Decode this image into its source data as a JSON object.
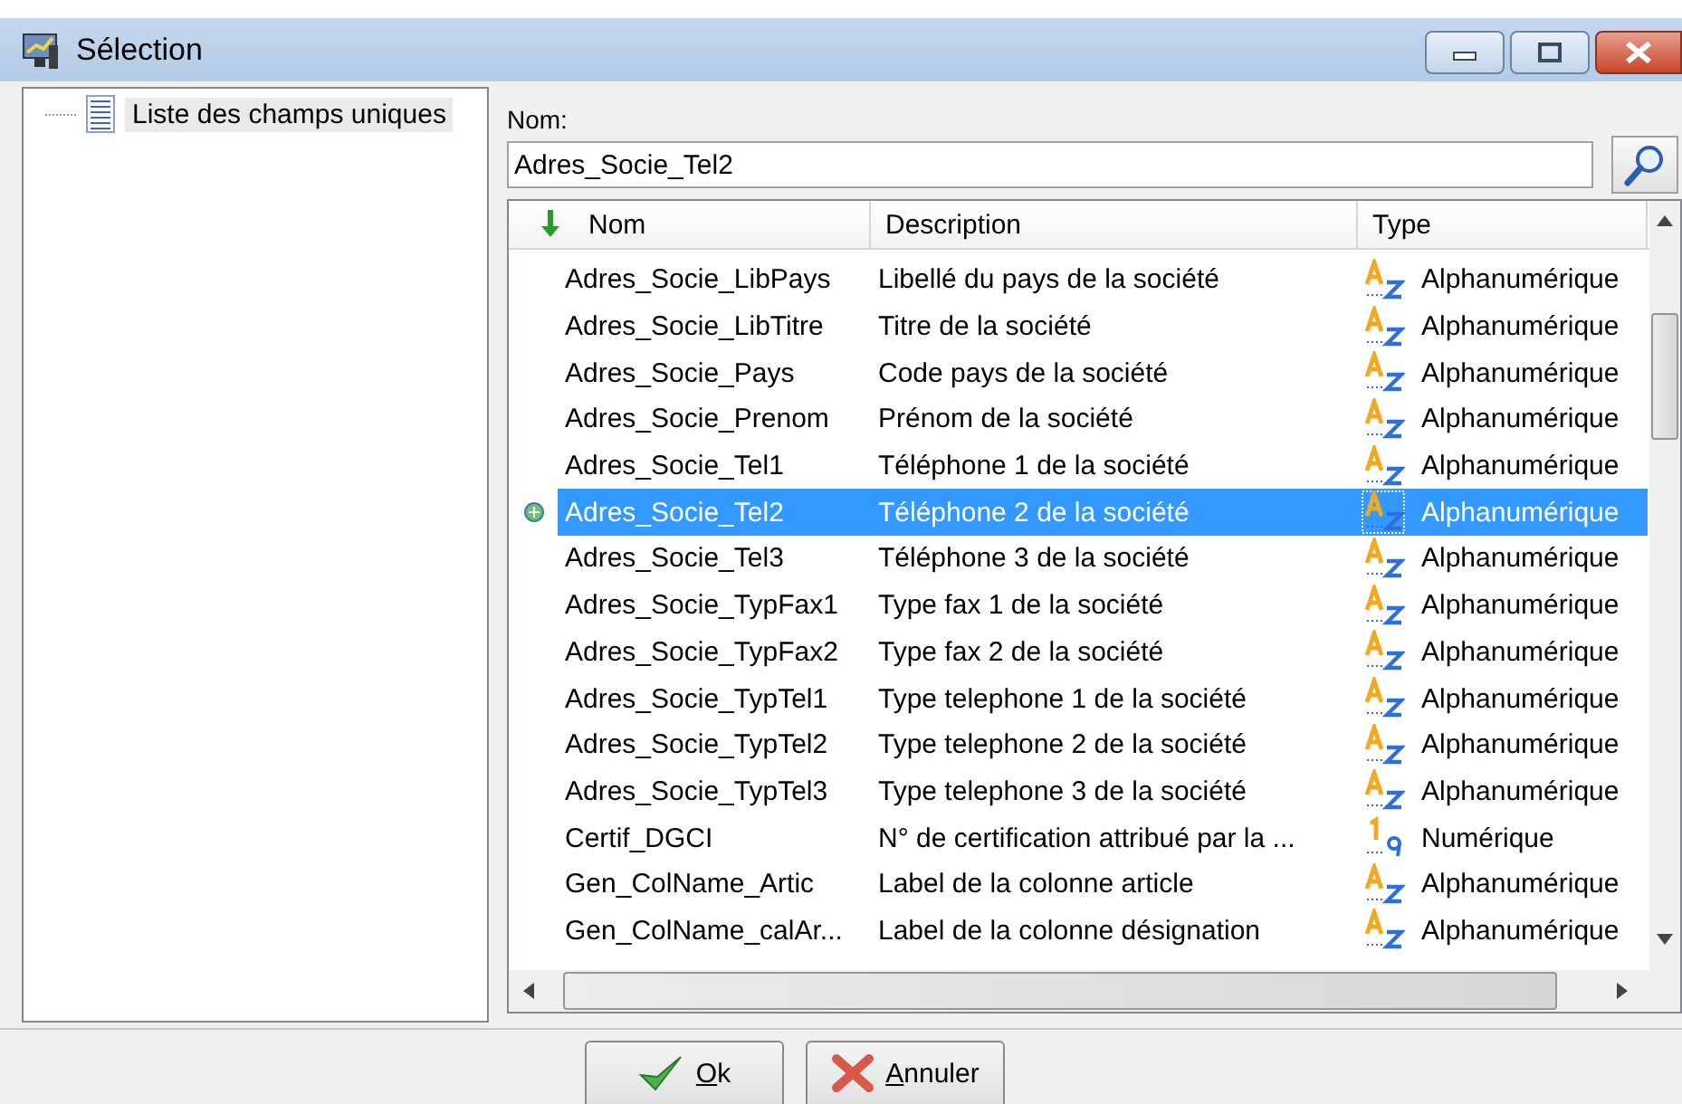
{
  "window": {
    "title": "Sélection"
  },
  "tree": {
    "items": [
      {
        "label": "Liste des champs uniques",
        "selected": true
      }
    ]
  },
  "name_field": {
    "label": "Nom:",
    "value": "Adres_Socie_Tel2"
  },
  "table": {
    "columns": [
      {
        "label": "Nom",
        "sorted": true
      },
      {
        "label": "Description",
        "sorted": false
      },
      {
        "label": "Type",
        "sorted": false
      }
    ],
    "rows": [
      {
        "name": "Adres_Socie_LibPays",
        "description": "Libellé du pays de la société",
        "type": "Alphanumérique",
        "kind": "alpha",
        "selected": false
      },
      {
        "name": "Adres_Socie_LibTitre",
        "description": "Titre de la société",
        "type": "Alphanumérique",
        "kind": "alpha",
        "selected": false
      },
      {
        "name": "Adres_Socie_Pays",
        "description": "Code pays de la société",
        "type": "Alphanumérique",
        "kind": "alpha",
        "selected": false
      },
      {
        "name": "Adres_Socie_Prenom",
        "description": "Prénom de la société",
        "type": "Alphanumérique",
        "kind": "alpha",
        "selected": false
      },
      {
        "name": "Adres_Socie_Tel1",
        "description": "Téléphone 1 de la société",
        "type": "Alphanumérique",
        "kind": "alpha",
        "selected": false
      },
      {
        "name": "Adres_Socie_Tel2",
        "description": "Téléphone 2 de la société",
        "type": "Alphanumérique",
        "kind": "alpha",
        "selected": true
      },
      {
        "name": "Adres_Socie_Tel3",
        "description": "Téléphone 3 de la société",
        "type": "Alphanumérique",
        "kind": "alpha",
        "selected": false
      },
      {
        "name": "Adres_Socie_TypFax1",
        "description": "Type fax 1 de la société",
        "type": "Alphanumérique",
        "kind": "alpha",
        "selected": false
      },
      {
        "name": "Adres_Socie_TypFax2",
        "description": "Type fax 2 de la société",
        "type": "Alphanumérique",
        "kind": "alpha",
        "selected": false
      },
      {
        "name": "Adres_Socie_TypTel1",
        "description": "Type telephone 1 de la société",
        "type": "Alphanumérique",
        "kind": "alpha",
        "selected": false
      },
      {
        "name": "Adres_Socie_TypTel2",
        "description": "Type telephone 2 de la société",
        "type": "Alphanumérique",
        "kind": "alpha",
        "selected": false
      },
      {
        "name": "Adres_Socie_TypTel3",
        "description": "Type telephone 3 de la société",
        "type": "Alphanumérique",
        "kind": "alpha",
        "selected": false
      },
      {
        "name": "Certif_DGCI",
        "description": "N° de certification attribué par la ...",
        "type": "Numérique",
        "kind": "numeric",
        "selected": false
      },
      {
        "name": "Gen_ColName_Artic",
        "description": "Label de la colonne article",
        "type": "Alphanumérique",
        "kind": "alpha",
        "selected": false
      },
      {
        "name": "Gen_ColName_calAr...",
        "description": "Label de la colonne désignation",
        "type": "Alphanumérique",
        "kind": "alpha",
        "selected": false
      }
    ]
  },
  "buttons": [
    {
      "label": "Ok",
      "kind": "ok"
    },
    {
      "label": "Annuler",
      "kind": "cancel"
    }
  ]
}
